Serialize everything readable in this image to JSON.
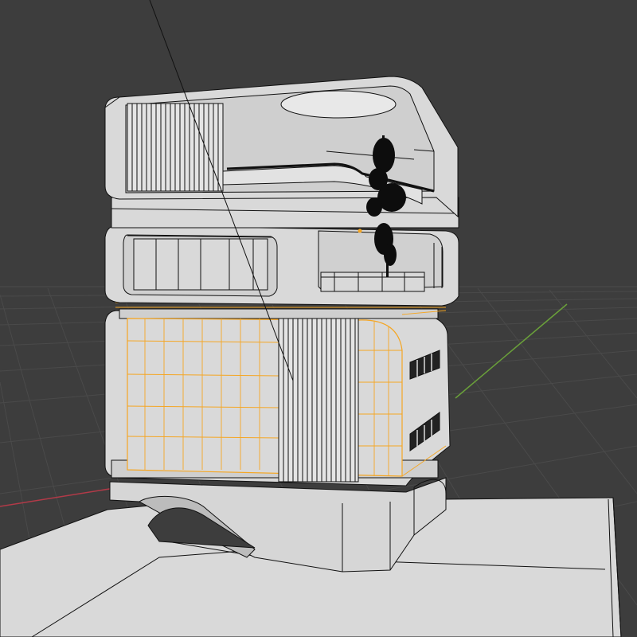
{
  "viewport": {
    "background_color": "#3d3d3d",
    "grid_line_color": "#4a4a4a",
    "x_axis_color": "#b23a48",
    "y_axis_color": "#6aa03a",
    "model_fill_color": "#d9d9d9",
    "model_shade_color": "#bdbdbd",
    "wire_color": "#111111",
    "selected_edge_color": "#f5a623",
    "foliage_color": "#0d0d0d"
  }
}
